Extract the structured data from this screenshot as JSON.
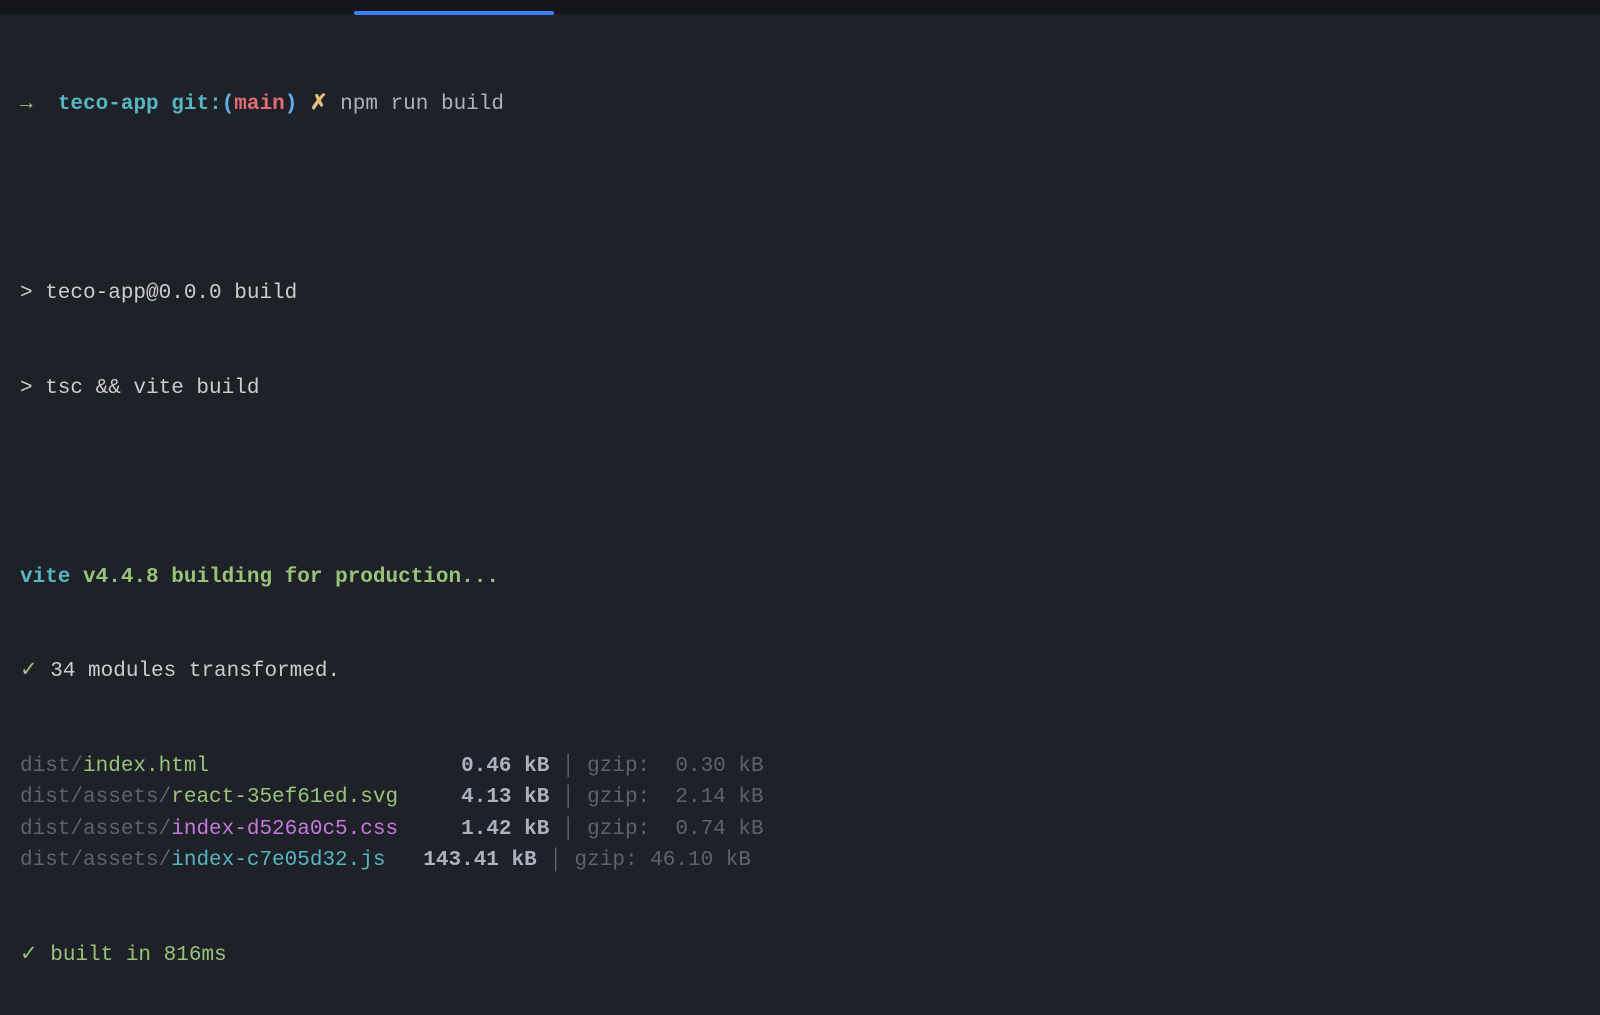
{
  "prompt": {
    "arrow": "→",
    "app": "teco-app",
    "git_label": "git:",
    "paren_open": "(",
    "branch": "main",
    "paren_close": ")",
    "dirty": "✗",
    "command": "npm run build"
  },
  "npm_output": {
    "line1": "> teco-app@0.0.0 build",
    "line2": "> tsc && vite build"
  },
  "vite": {
    "header_prefix": "vite",
    "version": "v4.4.8",
    "header_suffix": "building for production...",
    "check": "✓",
    "transformed": "34 modules transformed.",
    "files": [
      {
        "dir": "dist/",
        "name": "index.html",
        "size": "0.46 kB",
        "gzip": "0.30 kB",
        "file_class": "file-html",
        "pad": "                   ",
        "size_pad": " ",
        "gzip_pad": " "
      },
      {
        "dir": "dist/assets/",
        "name": "react-35ef61ed.svg",
        "size": "4.13 kB",
        "gzip": "2.14 kB",
        "file_class": "file-svg",
        "pad": "    ",
        "size_pad": " ",
        "gzip_pad": " "
      },
      {
        "dir": "dist/assets/",
        "name": "index-d526a0c5.css",
        "size": "1.42 kB",
        "gzip": "0.74 kB",
        "file_class": "file-css",
        "pad": "    ",
        "size_pad": " ",
        "gzip_pad": " "
      },
      {
        "dir": "dist/assets/",
        "name": "index-c7e05d32.js",
        "size": "143.41 kB",
        "gzip": "46.10 kB",
        "file_class": "file-js",
        "pad": "   ",
        "size_pad": "",
        "gzip_pad": ""
      }
    ],
    "built_check": "✓",
    "built_msg": "built in 816ms"
  },
  "labels": {
    "pipe": "│",
    "gzip_prefix": "gzip: "
  }
}
